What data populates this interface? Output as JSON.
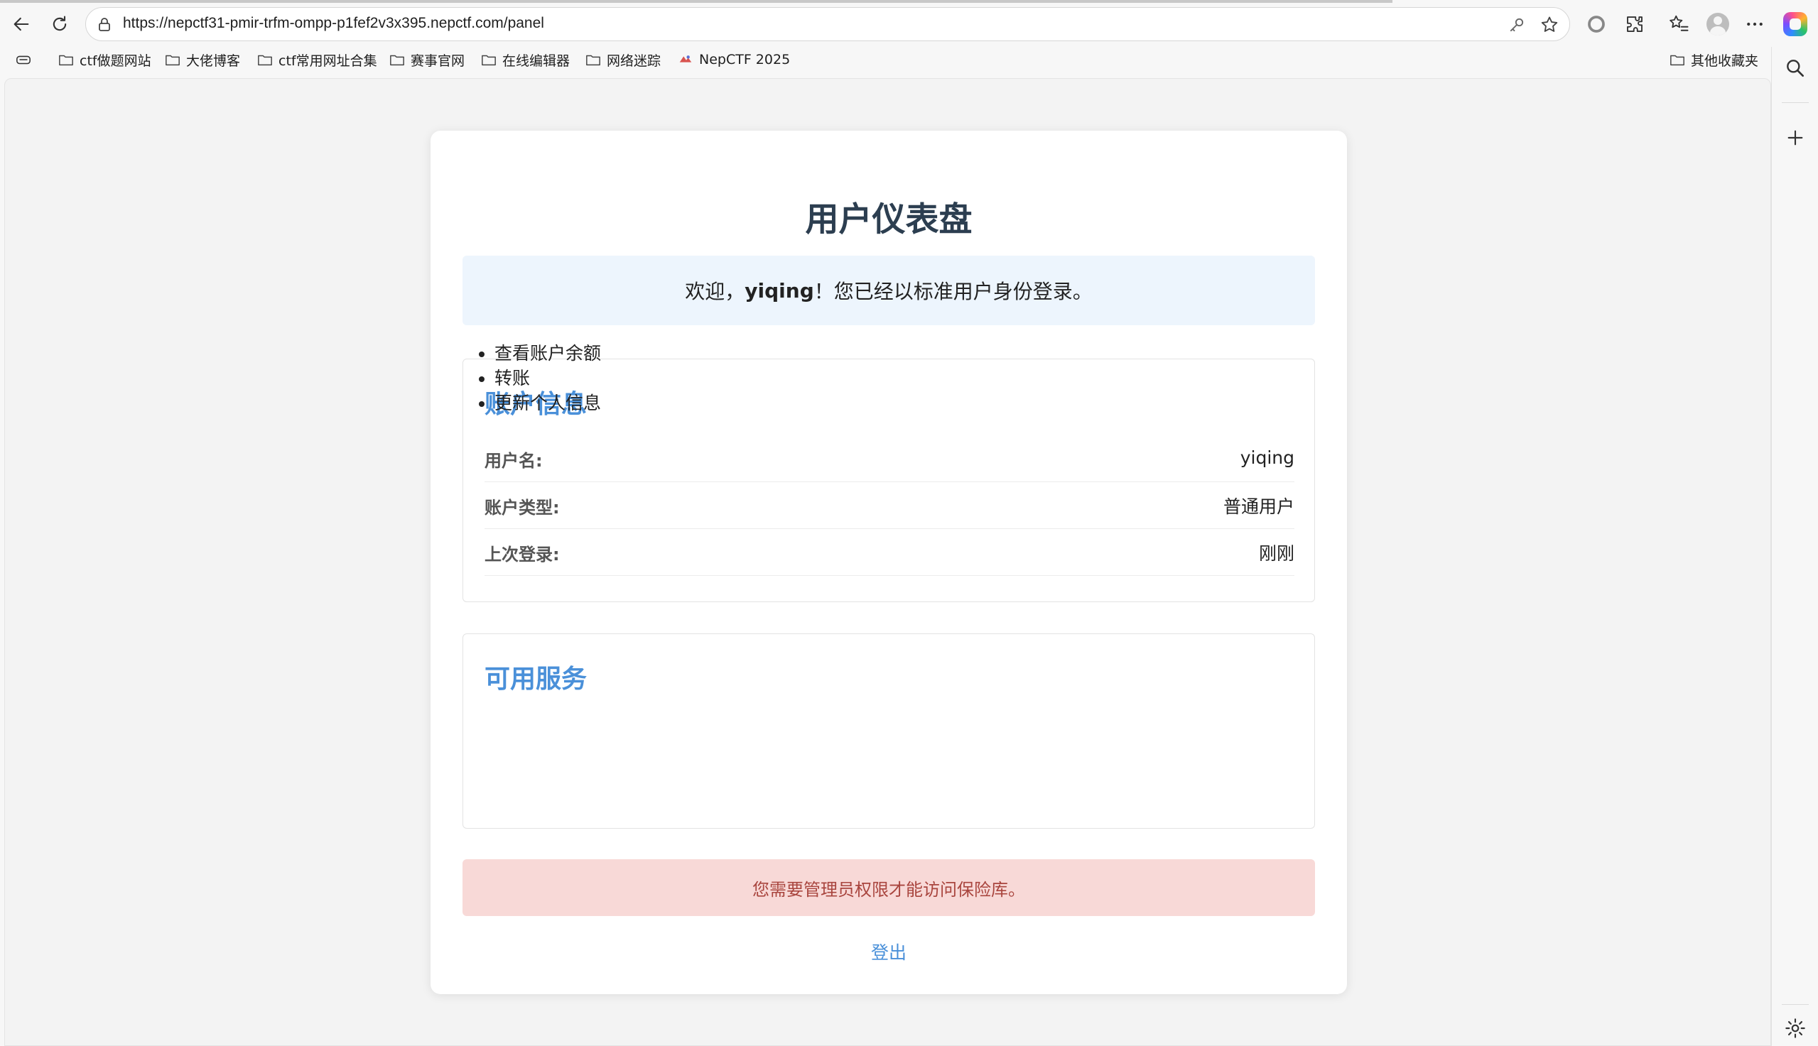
{
  "browser": {
    "url": "https://nepctf31-pmir-trfm-ompp-p1fef2v3x395.nepctf.com/panel",
    "bookmarks": [
      "ctf做题网站",
      "大佬博客",
      "ctf常用网址合集",
      "赛事官网",
      "在线编辑器",
      "网络迷踪",
      "NepCTF 2025"
    ],
    "other_bookmarks": "其他收藏夹"
  },
  "page": {
    "title": "用户仪表盘",
    "welcome": {
      "prefix": "欢迎，",
      "username": "yiqing",
      "suffix": "！您已经以标准用户身份登录。"
    },
    "account": {
      "title": "账户信息",
      "rows": [
        {
          "label": "用户名:",
          "value": "yiqing"
        },
        {
          "label": "账户类型:",
          "value": "普通用户"
        },
        {
          "label": "上次登录:",
          "value": "刚刚"
        }
      ]
    },
    "services": {
      "title": "可用服务",
      "items": [
        "查看账户余额",
        "转账",
        "更新个人信息"
      ]
    },
    "vault_alert": "您需要管理员权限才能访问保险库。",
    "logout": "登出"
  },
  "colors": {
    "accent": "#4a90d9",
    "title": "#2c3e50",
    "alert_bg": "#f8d9d7",
    "alert_text": "#a9453e",
    "welcome_bg": "#edf5fd"
  }
}
